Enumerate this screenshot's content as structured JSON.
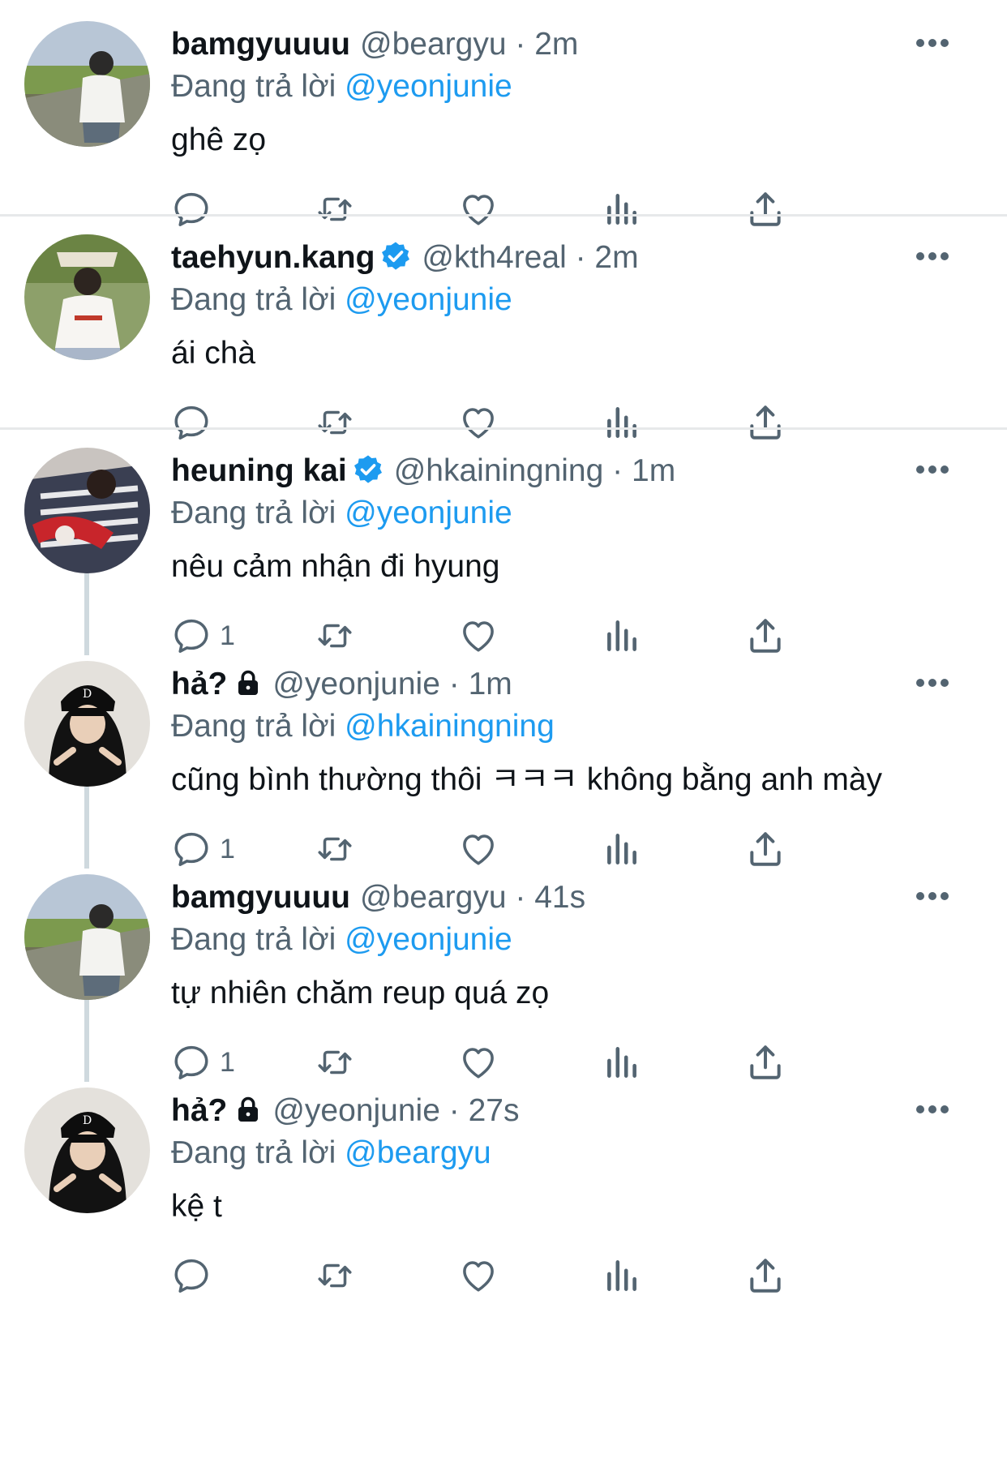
{
  "colors": {
    "accent": "#1d9bf0",
    "secondary_text": "#536471",
    "primary_text": "#0f1419",
    "thread_line": "#cfd9de",
    "divider": "#e7e9ea"
  },
  "icons": {
    "reply": "reply-icon",
    "retweet": "retweet-icon",
    "like": "like-icon",
    "views": "views-icon",
    "share": "share-icon",
    "more": "more-icon",
    "verified": "verified-badge-icon",
    "lock": "lock-icon"
  },
  "tweets": [
    {
      "name": "bamgyuuuu",
      "handle": "@beargyu",
      "separator": "·",
      "time": "2m",
      "reply_prefix": "Đang trả lời",
      "reply_to": "@yeonjunie",
      "text": "ghê zọ",
      "reply_count": ""
    },
    {
      "name": "taehyun.kang",
      "handle": "@kth4real",
      "separator": "·",
      "time": "2m",
      "reply_prefix": "Đang trả lời",
      "reply_to": "@yeonjunie",
      "text": "ái chà",
      "reply_count": ""
    },
    {
      "name": "heuning kai",
      "handle": "@hkainingning",
      "separator": "·",
      "time": "1m",
      "reply_prefix": "Đang trả lời",
      "reply_to": "@yeonjunie",
      "text": "nêu cảm nhận đi hyung",
      "reply_count": "1"
    },
    {
      "name": "hả?",
      "handle": "@yeonjunie",
      "separator": "·",
      "time": "1m",
      "reply_prefix": "Đang trả lời",
      "reply_to": "@hkainingning",
      "text": "cũng bình thường thôi ㅋㅋㅋ không bằng anh mày",
      "reply_count": "1"
    },
    {
      "name": "bamgyuuuu",
      "handle": "@beargyu",
      "separator": "·",
      "time": "41s",
      "reply_prefix": "Đang trả lời",
      "reply_to": "@yeonjunie",
      "text": "tự nhiên chăm reup quá zọ",
      "reply_count": "1"
    },
    {
      "name": "hả?",
      "handle": "@yeonjunie",
      "separator": "·",
      "time": "27s",
      "reply_prefix": "Đang trả lời",
      "reply_to": "@beargyu",
      "text": "kệ t",
      "reply_count": ""
    }
  ]
}
